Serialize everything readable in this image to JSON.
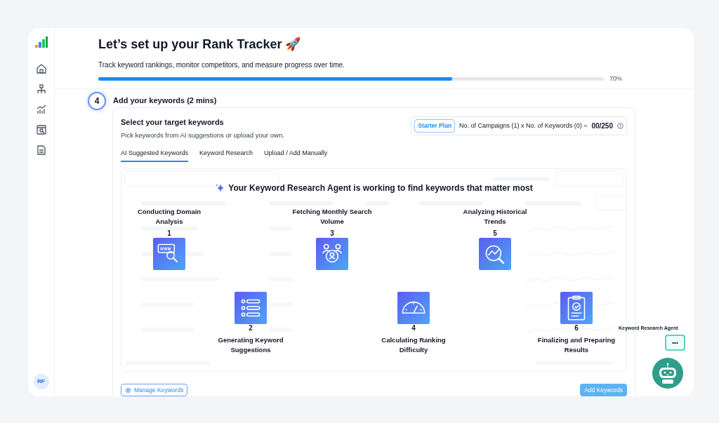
{
  "sidebar": {
    "avatar": "RF"
  },
  "header": {
    "title": "Let’s set up your Rank Tracker 🚀",
    "subtitle": "Track keyword rankings, monitor competitors, and measure progress over time.",
    "progress": {
      "level": 0.7,
      "reading": "70%"
    }
  },
  "step": {
    "number": "4",
    "title": "Add your keywords (2 mins)"
  },
  "card": {
    "heading": "Select your target keywords",
    "subheading": "Pick keywords from AI suggestions or upload your own.",
    "plan": "Starter Plan",
    "quota_text": "No. of Campaigns (1) x No. of Keywords (0) =",
    "quota_value": "00/250"
  },
  "tabs": [
    {
      "label": "AI Suggested Keywords",
      "selected": true
    },
    {
      "label": "Keyword Research",
      "selected": false
    },
    {
      "label": "Upload / Add Manually",
      "selected": false
    }
  ],
  "agent_overlay": {
    "headline": "Your Keyword Research Agent is working to find keywords that matter most",
    "steps": [
      {
        "number": "1",
        "label": "Conducting Domain Analysis",
        "kind": "domain"
      },
      {
        "number": "2",
        "label": "Generating Keyword Suggestions",
        "kind": "list"
      },
      {
        "number": "3",
        "label": "Fetching Monthly Search Volume",
        "kind": "people"
      },
      {
        "number": "4",
        "label": "Calculating Ranking Difficulty",
        "kind": "gauge"
      },
      {
        "number": "5",
        "label": "Analyzing Historical Trends",
        "kind": "trend"
      },
      {
        "number": "6",
        "label": "Finalizing and Preparing Results",
        "kind": "clipboard"
      }
    ]
  },
  "buttons": {
    "manage": "Manage Keywords",
    "add": "Add Keywords"
  },
  "agent": {
    "label": "Keyword Research Agent",
    "menu": "•••"
  }
}
